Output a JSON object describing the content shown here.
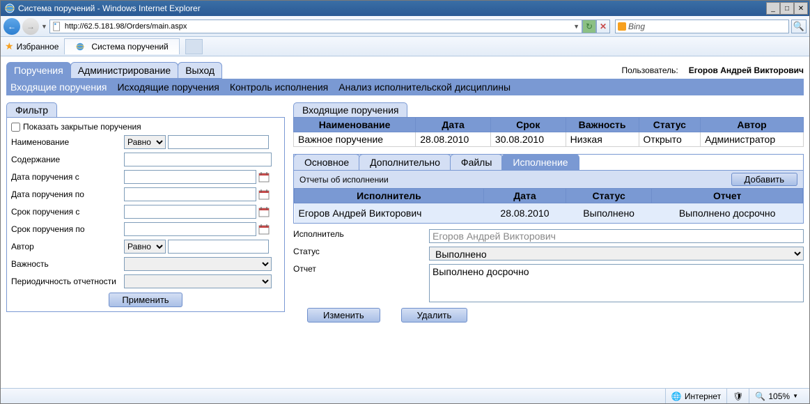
{
  "window": {
    "title": "Система поручений - Windows Internet Explorer",
    "url": "http://62.5.181.98/Orders/main.aspx",
    "search_engine": "Bing"
  },
  "favorites": {
    "label": "Избранное",
    "tab_title": "Система поручений"
  },
  "header": {
    "user_label": "Пользователь:",
    "user_name": "Егоров Андрей Викторович"
  },
  "main_tabs": [
    "Поручения",
    "Администрирование",
    "Выход"
  ],
  "sub_tabs": [
    "Входящие поручения",
    "Исходящие поручения",
    "Контроль исполнения",
    "Анализ исполнительской дисциплины"
  ],
  "filter": {
    "tab": "Фильтр",
    "show_closed": "Показать закрытые поручения",
    "labels": {
      "name": "Наименование",
      "content": "Содержание",
      "date_from": "Дата поручения с",
      "date_to": "Дата поручения по",
      "due_from": "Срок поручения с",
      "due_to": "Срок поручения по",
      "author": "Автор",
      "importance": "Важность",
      "periodicity": "Периодичность отчетности"
    },
    "op_equals": "Равно",
    "apply": "Применить"
  },
  "incoming": {
    "tab": "Входящие поручения",
    "cols": [
      "Наименование",
      "Дата",
      "Срок",
      "Важность",
      "Статус",
      "Автор"
    ],
    "row": [
      "Важное поручение",
      "28.08.2010",
      "30.08.2010",
      "Низкая",
      "Открыто",
      "Администратор"
    ]
  },
  "detail_tabs": [
    "Основное",
    "Дополнительно",
    "Файлы",
    "Исполнение"
  ],
  "reports": {
    "title": "Отчеты об исполнении",
    "add": "Добавить",
    "cols": [
      "Исполнитель",
      "Дата",
      "Статус",
      "Отчет"
    ],
    "row": [
      "Егоров Андрей Викторович",
      "28.08.2010",
      "Выполнено",
      "Выполнено досрочно"
    ]
  },
  "form": {
    "labels": {
      "executor": "Исполнитель",
      "status": "Статус",
      "report": "Отчет"
    },
    "values": {
      "executor": "Егоров Андрей Викторович",
      "status": "Выполнено",
      "report": "Выполнено досрочно"
    },
    "buttons": {
      "edit": "Изменить",
      "delete": "Удалить"
    }
  },
  "status": {
    "zone": "Интернет",
    "zoom": "105%"
  }
}
